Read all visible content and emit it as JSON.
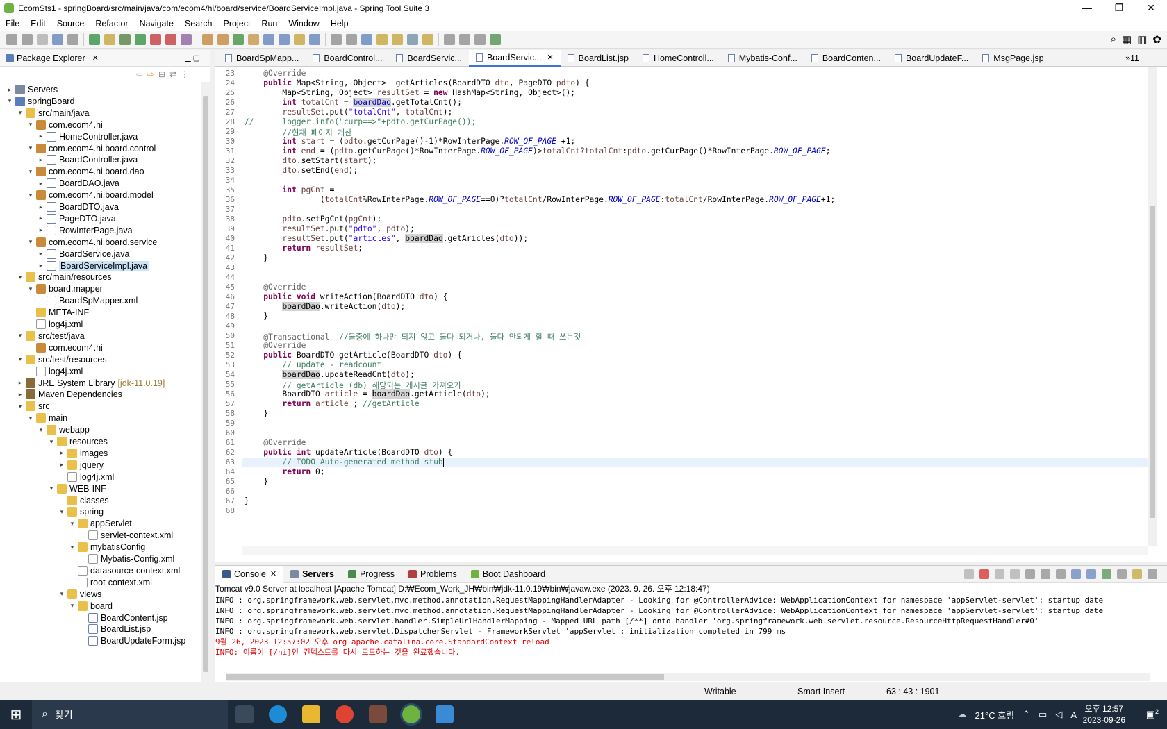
{
  "window": {
    "title": "EcomSts1 - springBoard/src/main/java/com/ecom4/hi/board/service/BoardServiceImpl.java - Spring Tool Suite 3",
    "controls": {
      "minimize": "—",
      "maximize": "❐",
      "close": "✕"
    }
  },
  "menu": [
    "File",
    "Edit",
    "Source",
    "Refactor",
    "Navigate",
    "Search",
    "Project",
    "Run",
    "Window",
    "Help"
  ],
  "package_explorer": {
    "title": "Package Explorer",
    "tree": [
      {
        "label": "Servers",
        "depth": 0,
        "icon": "srv",
        "arrow": "▸"
      },
      {
        "label": "springBoard",
        "depth": 0,
        "icon": "proj",
        "arrow": "▾"
      },
      {
        "label": "src/main/java",
        "depth": 1,
        "icon": "folder",
        "arrow": "▾"
      },
      {
        "label": "com.ecom4.hi",
        "depth": 2,
        "icon": "pkg",
        "arrow": "▾"
      },
      {
        "label": "HomeController.java",
        "depth": 3,
        "icon": "file",
        "arrow": "▸"
      },
      {
        "label": "com.ecom4.hi.board.control",
        "depth": 2,
        "icon": "pkg",
        "arrow": "▾"
      },
      {
        "label": "BoardController.java",
        "depth": 3,
        "icon": "file",
        "arrow": "▸"
      },
      {
        "label": "com.ecom4.hi.board.dao",
        "depth": 2,
        "icon": "pkg",
        "arrow": "▾"
      },
      {
        "label": "BoardDAO.java",
        "depth": 3,
        "icon": "file",
        "arrow": "▸"
      },
      {
        "label": "com.ecom4.hi.board.model",
        "depth": 2,
        "icon": "pkg",
        "arrow": "▾"
      },
      {
        "label": "BoardDTO.java",
        "depth": 3,
        "icon": "file",
        "arrow": "▸"
      },
      {
        "label": "PageDTO.java",
        "depth": 3,
        "icon": "file",
        "arrow": "▸"
      },
      {
        "label": "RowInterPage.java",
        "depth": 3,
        "icon": "file",
        "arrow": "▸"
      },
      {
        "label": "com.ecom4.hi.board.service",
        "depth": 2,
        "icon": "pkg",
        "arrow": "▾"
      },
      {
        "label": "BoardService.java",
        "depth": 3,
        "icon": "file",
        "arrow": "▸"
      },
      {
        "label": "BoardServiceImpl.java",
        "depth": 3,
        "icon": "file",
        "arrow": "▸",
        "selected": true
      },
      {
        "label": "src/main/resources",
        "depth": 1,
        "icon": "folder",
        "arrow": "▾"
      },
      {
        "label": "board.mapper",
        "depth": 2,
        "icon": "pkg",
        "arrow": "▾"
      },
      {
        "label": "BoardSpMapper.xml",
        "depth": 3,
        "icon": "xml",
        "arrow": ""
      },
      {
        "label": "META-INF",
        "depth": 2,
        "icon": "folder",
        "arrow": ""
      },
      {
        "label": "log4j.xml",
        "depth": 2,
        "icon": "xml",
        "arrow": ""
      },
      {
        "label": "src/test/java",
        "depth": 1,
        "icon": "folder",
        "arrow": "▾"
      },
      {
        "label": "com.ecom4.hi",
        "depth": 2,
        "icon": "pkg",
        "arrow": ""
      },
      {
        "label": "src/test/resources",
        "depth": 1,
        "icon": "folder",
        "arrow": "▾"
      },
      {
        "label": "log4j.xml",
        "depth": 2,
        "icon": "xml",
        "arrow": ""
      },
      {
        "label": "JRE System Library",
        "suffix": "[jdk-11.0.19]",
        "depth": 1,
        "icon": "lib",
        "arrow": "▸"
      },
      {
        "label": "Maven Dependencies",
        "depth": 1,
        "icon": "lib",
        "arrow": "▸"
      },
      {
        "label": "src",
        "depth": 1,
        "icon": "folder",
        "arrow": "▾"
      },
      {
        "label": "main",
        "depth": 2,
        "icon": "folder",
        "arrow": "▾"
      },
      {
        "label": "webapp",
        "depth": 3,
        "icon": "folder",
        "arrow": "▾"
      },
      {
        "label": "resources",
        "depth": 4,
        "icon": "folder",
        "arrow": "▾"
      },
      {
        "label": "images",
        "depth": 5,
        "icon": "folder",
        "arrow": "▸"
      },
      {
        "label": "jquery",
        "depth": 5,
        "icon": "folder",
        "arrow": "▸"
      },
      {
        "label": "log4j.xml",
        "depth": 5,
        "icon": "xml",
        "arrow": ""
      },
      {
        "label": "WEB-INF",
        "depth": 4,
        "icon": "folder",
        "arrow": "▾"
      },
      {
        "label": "classes",
        "depth": 5,
        "icon": "folder",
        "arrow": ""
      },
      {
        "label": "spring",
        "depth": 5,
        "icon": "folder",
        "arrow": "▾"
      },
      {
        "label": "appServlet",
        "depth": 6,
        "icon": "folder",
        "arrow": "▾"
      },
      {
        "label": "servlet-context.xml",
        "depth": 7,
        "icon": "xml",
        "arrow": ""
      },
      {
        "label": "mybatisConfig",
        "depth": 6,
        "icon": "folder",
        "arrow": "▾"
      },
      {
        "label": "Mybatis-Config.xml",
        "depth": 7,
        "icon": "xml",
        "arrow": ""
      },
      {
        "label": "datasource-context.xml",
        "depth": 6,
        "icon": "xml",
        "arrow": ""
      },
      {
        "label": "root-context.xml",
        "depth": 6,
        "icon": "xml",
        "arrow": ""
      },
      {
        "label": "views",
        "depth": 5,
        "icon": "folder",
        "arrow": "▾"
      },
      {
        "label": "board",
        "depth": 6,
        "icon": "folder",
        "arrow": "▾"
      },
      {
        "label": "BoardContent.jsp",
        "depth": 7,
        "icon": "file",
        "arrow": ""
      },
      {
        "label": "BoardList.jsp",
        "depth": 7,
        "icon": "file",
        "arrow": ""
      },
      {
        "label": "BoardUpdateForm.jsp",
        "depth": 7,
        "icon": "file",
        "arrow": ""
      }
    ]
  },
  "editor_tabs": [
    {
      "label": "BoardSpMapp..."
    },
    {
      "label": "BoardControl..."
    },
    {
      "label": "BoardServic..."
    },
    {
      "label": "BoardServic...",
      "active": true
    },
    {
      "label": "BoardList.jsp"
    },
    {
      "label": "HomeControll..."
    },
    {
      "label": "Mybatis-Conf..."
    },
    {
      "label": "BoardConten..."
    },
    {
      "label": "BoardUpdateF..."
    },
    {
      "label": "MsgPage.jsp"
    }
  ],
  "more_tabs": "»11",
  "code_lines": [
    {
      "n": "23",
      "html": "    <span class='ann'>@Override</span>"
    },
    {
      "n": "24",
      "html": "    <span class='kw'>public</span> Map&lt;String, Object&gt;  getArticles(BoardDTO <span class='var'>dto</span>, PageDTO <span class='var'>pdto</span>) {"
    },
    {
      "n": "25",
      "html": "        Map&lt;String, Object&gt; <span class='var'>resultSet</span> = <span class='kw'>new</span> HashMap&lt;String, Object&gt;();"
    },
    {
      "n": "26",
      "html": "        <span class='kw'>int</span> <span class='var'>totalCnt</span> = <span class='hl fld' style='font-style:normal'>boardDao</span>.getTotalCnt();"
    },
    {
      "n": "27",
      "html": "        <span class='var'>resultSet</span>.put(<span class='str'>\"totalCnt\"</span>, <span class='var'>totalCnt</span>);"
    },
    {
      "n": "28",
      "html": "<span class='com'>//      logger.info(\"curp==&gt;\"+pdto.getCurPage());</span>"
    },
    {
      "n": "29",
      "html": "        <span class='com'>//현재 페이지 계산</span>"
    },
    {
      "n": "30",
      "html": "        <span class='kw'>int</span> <span class='var'>start</span> = (<span class='var'>pdto</span>.getCurPage()-1)*RowInterPage.<span class='fld'>ROW_OF_PAGE</span> +1;"
    },
    {
      "n": "31",
      "html": "        <span class='kw'>int</span> <span class='var'>end</span> = (<span class='var'>pdto</span>.getCurPage()*RowInterPage.<span class='fld'>ROW_OF_PAGE</span>)&gt;<span class='var'>totalCnt</span>?<span class='var'>totalCnt</span>:<span class='var'>pdto</span>.getCurPage()*RowInterPage.<span class='fld'>ROW_OF_PAGE</span>;"
    },
    {
      "n": "32",
      "html": "        <span class='var'>dto</span>.setStart(<span class='var'>start</span>);"
    },
    {
      "n": "33",
      "html": "        <span class='var'>dto</span>.setEnd(<span class='var'>end</span>);"
    },
    {
      "n": "34",
      "html": ""
    },
    {
      "n": "35",
      "html": "        <span class='kw'>int</span> <span class='var'>pgCnt</span> ="
    },
    {
      "n": "36",
      "html": "                (<span class='var'>totalCnt</span>%RowInterPage.<span class='fld'>ROW_OF_PAGE</span>==0)?<span class='var'>totalCnt</span>/RowInterPage.<span class='fld'>ROW_OF_PAGE</span>:<span class='var'>totalCnt</span>/RowInterPage.<span class='fld'>ROW_OF_PAGE</span>+1;"
    },
    {
      "n": "37",
      "html": ""
    },
    {
      "n": "38",
      "html": "        <span class='var'>pdto</span>.setPgCnt(<span class='var'>pgCnt</span>);"
    },
    {
      "n": "39",
      "html": "        <span class='var'>resultSet</span>.put(<span class='str'>\"pdto\"</span>, <span class='var'>pdto</span>);"
    },
    {
      "n": "40",
      "html": "        <span class='var'>resultSet</span>.put(<span class='str'>\"articles\"</span>, <span class='hl'>boardDao</span>.getAricles(<span class='var'>dto</span>));"
    },
    {
      "n": "41",
      "html": "        <span class='kw'>return</span> <span class='var'>resultSet</span>;"
    },
    {
      "n": "42",
      "html": "    }"
    },
    {
      "n": "43",
      "html": ""
    },
    {
      "n": "44",
      "html": ""
    },
    {
      "n": "45",
      "html": "    <span class='ann'>@Override</span>"
    },
    {
      "n": "46",
      "html": "    <span class='kw'>public</span> <span class='kw'>void</span> writeAction(BoardDTO <span class='var'>dto</span>) {"
    },
    {
      "n": "47",
      "html": "        <span class='hl'>boardDao</span>.writeAction(<span class='var'>dto</span>);"
    },
    {
      "n": "48",
      "html": "    }"
    },
    {
      "n": "49",
      "html": ""
    },
    {
      "n": "50",
      "html": "    <span class='ann'>@Transactional</span>  <span class='com'>//둘중에 하나만 되지 않고 둘다 되거나, 둘다 안되게 할 때 쓰는것</span>"
    },
    {
      "n": "51",
      "html": "    <span class='ann'>@Override</span>"
    },
    {
      "n": "52",
      "html": "    <span class='kw'>public</span> BoardDTO getArticle(BoardDTO <span class='var'>dto</span>) {"
    },
    {
      "n": "53",
      "html": "        <span class='com'>// update - readcount</span>"
    },
    {
      "n": "54",
      "html": "        <span class='hl'>boardDao</span>.updateReadCnt(<span class='var'>dto</span>);"
    },
    {
      "n": "55",
      "html": "        <span class='com'>// getArticle (db) 해당되는 게시글 가져오기</span>"
    },
    {
      "n": "56",
      "html": "        BoardDTO <span class='var'>article</span> = <span class='hl'>boardDao</span>.getArticle(<span class='var'>dto</span>);"
    },
    {
      "n": "57",
      "html": "        <span class='kw'>return</span> <span class='var'>article</span> ; <span class='com'>//getArticle</span>"
    },
    {
      "n": "58",
      "html": "    }"
    },
    {
      "n": "59",
      "html": ""
    },
    {
      "n": "60",
      "html": ""
    },
    {
      "n": "61",
      "html": "    <span class='ann'>@Override</span>"
    },
    {
      "n": "62",
      "html": "    <span class='kw'>public</span> <span class='kw'>int</span> updateArticle(BoardDTO <span class='var'>dto</span>) {"
    },
    {
      "n": "63",
      "html": "        <span class='com'>// TODO Auto-generated method stub</span>",
      "current": true
    },
    {
      "n": "64",
      "html": "        <span class='kw'>return</span> 0;"
    },
    {
      "n": "65",
      "html": "    }"
    },
    {
      "n": "66",
      "html": ""
    },
    {
      "n": "67",
      "html": "}"
    },
    {
      "n": "68",
      "html": ""
    }
  ],
  "console": {
    "tabs": [
      {
        "label": "Console",
        "active": true,
        "color": "#3a5a8a"
      },
      {
        "label": "Servers",
        "bold": true,
        "color": "#7a8aa0"
      },
      {
        "label": "Progress",
        "color": "#4a8a4a"
      },
      {
        "label": "Problems",
        "color": "#b04040"
      },
      {
        "label": "Boot Dashboard",
        "color": "#6db33f"
      }
    ],
    "description": "Tomcat v9.0 Server at localhost [Apache Tomcat] D:₩Ecom_Work_JH₩bin₩jdk-11.0.19₩bin₩javaw.exe  (2023. 9. 26. 오후 12:18:47)",
    "lines": [
      {
        "text": "INFO : org.springframework.web.servlet.mvc.method.annotation.RequestMappingHandlerAdapter - Looking for @ControllerAdvice: WebApplicationContext for namespace 'appServlet-servlet': startup date",
        "red": false
      },
      {
        "text": "INFO : org.springframework.web.servlet.mvc.method.annotation.RequestMappingHandlerAdapter - Looking for @ControllerAdvice: WebApplicationContext for namespace 'appServlet-servlet': startup date",
        "red": false
      },
      {
        "text": "INFO : org.springframework.web.servlet.handler.SimpleUrlHandlerMapping - Mapped URL path [/**] onto handler 'org.springframework.web.servlet.resource.ResourceHttpRequestHandler#0'",
        "red": false
      },
      {
        "text": "INFO : org.springframework.web.servlet.DispatcherServlet - FrameworkServlet 'appServlet': initialization completed in 799 ms",
        "red": false
      },
      {
        "text": "9월 26, 2023 12:57:02 오후 org.apache.catalina.core.StandardContext reload",
        "red": true
      },
      {
        "text": "INFO: 이름이 [/hi]인 컨텍스트를 다시 로드하는 것을 완료했습니다.",
        "red": true
      }
    ]
  },
  "status": {
    "writable": "Writable",
    "insert": "Smart Insert",
    "position": "63 : 43 : 1901"
  },
  "taskbar": {
    "search": "찾기",
    "weather": "21°C  흐림",
    "time": "오후 12:57",
    "date": "2023-09-26",
    "notifications": "2",
    "ime": "A"
  }
}
